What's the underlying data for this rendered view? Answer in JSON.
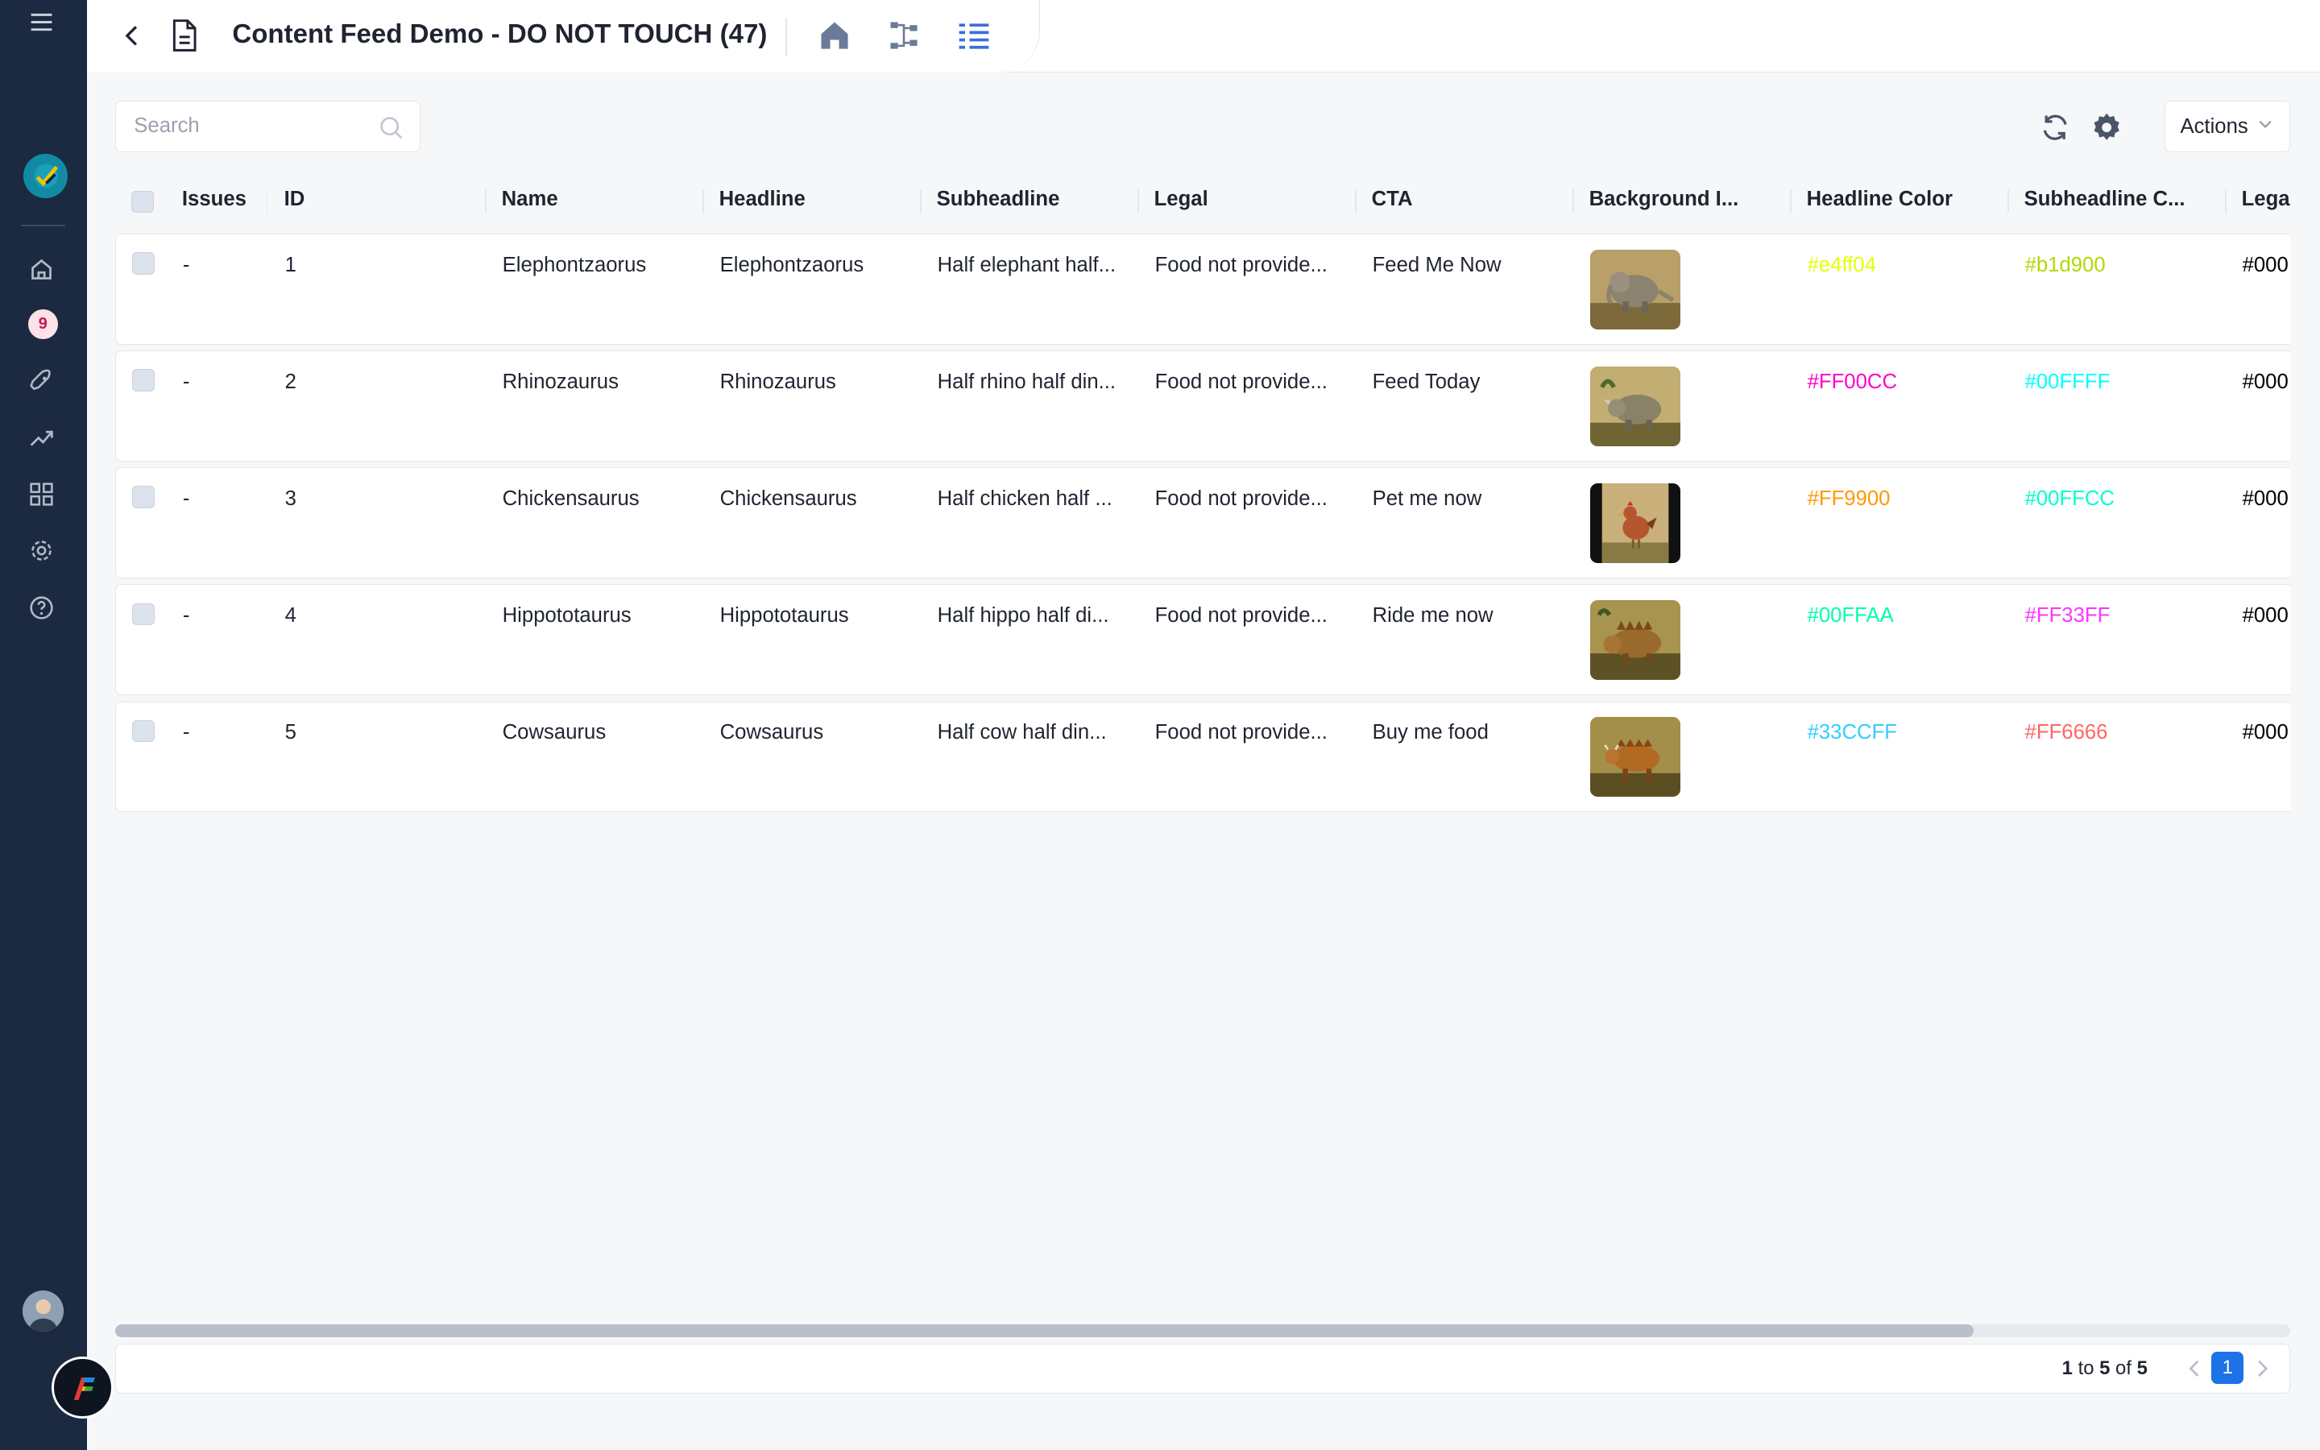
{
  "sidebar": {
    "badge_count": "9",
    "icons": [
      "menu-icon",
      "app-logo",
      "home-icon",
      "notifications-badge",
      "rocket-icon",
      "trend-icon",
      "grid-icon",
      "settings-icon",
      "help-icon",
      "avatar",
      "brand-icon"
    ]
  },
  "header": {
    "title": "Content Feed Demo - DO NOT TOUCH (47)",
    "views": [
      "home-view-icon",
      "flow-view-icon",
      "table-view-icon"
    ],
    "active_view": "table-view-icon",
    "active_color": "#3a6fd8"
  },
  "toolbar": {
    "search_placeholder": "Search",
    "actions_label": "Actions"
  },
  "table": {
    "columns": [
      "Issues",
      "ID",
      "Name",
      "Headline",
      "Subheadline",
      "Legal",
      "CTA",
      "Background I...",
      "Headline Color",
      "Subheadline C...",
      "Lega"
    ],
    "rows": [
      {
        "issues": "-",
        "id": "1",
        "name": "Elephontzaorus",
        "headline": "Elephontzaorus",
        "subheadline": "Half elephant half...",
        "legal": "Food not provide...",
        "cta": "Feed Me Now",
        "image": "elephant-dinosaur",
        "headline_color": "#e4ff04",
        "subheadline_color": "#b1d900",
        "legal_color": "#000"
      },
      {
        "issues": "-",
        "id": "2",
        "name": "Rhinozaurus",
        "headline": "Rhinozaurus",
        "subheadline": "Half rhino half din...",
        "legal": "Food not provide...",
        "cta": "Feed Today",
        "image": "rhino-dinosaur",
        "headline_color": "#FF00CC",
        "subheadline_color": "#00FFFF",
        "legal_color": "#000"
      },
      {
        "issues": "-",
        "id": "3",
        "name": "Chickensaurus",
        "headline": "Chickensaurus",
        "subheadline": "Half chicken half ...",
        "legal": "Food not provide...",
        "cta": "Pet me now",
        "image": "chicken-dinosaur",
        "headline_color": "#FF9900",
        "subheadline_color": "#00FFCC",
        "legal_color": "#000"
      },
      {
        "issues": "-",
        "id": "4",
        "name": "Hippototaurus",
        "headline": "Hippototaurus",
        "subheadline": "Half hippo half di...",
        "legal": "Food not provide...",
        "cta": "Ride me now",
        "image": "hippo-dinosaur",
        "headline_color": "#00FFAA",
        "subheadline_color": "#FF33FF",
        "legal_color": "#000"
      },
      {
        "issues": "-",
        "id": "5",
        "name": "Cowsaurus",
        "headline": "Cowsaurus",
        "subheadline": "Half cow half din...",
        "legal": "Food not provide...",
        "cta": "Buy me food",
        "image": "cow-dinosaur",
        "headline_color": "#33CCFF",
        "subheadline_color": "#FF6666",
        "legal_color": "#000"
      }
    ]
  },
  "pagination": {
    "from": "1",
    "to_word": "to",
    "to": "5",
    "of_word": "of",
    "total": "5",
    "current_page": "1"
  }
}
